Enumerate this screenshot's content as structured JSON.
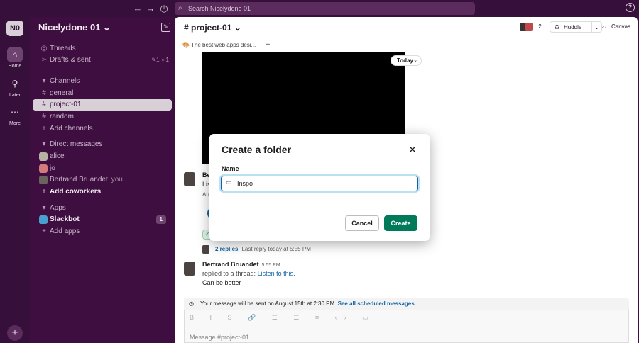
{
  "topbar": {
    "search_placeholder": "Search Nicelydone 01",
    "back_icon": "←",
    "forward_icon": "→",
    "history_icon": "◷",
    "help_icon": "?"
  },
  "rail": {
    "workspace_initials": "N0",
    "items": [
      {
        "label": "Home",
        "icon": "⌂"
      },
      {
        "label": "Later",
        "icon": "⚲"
      },
      {
        "label": "More",
        "icon": "⋯"
      }
    ],
    "add_icon": "+"
  },
  "sidebar": {
    "workspace_name": "Nicelydone 01 ⌄",
    "threads": "Threads",
    "drafts": "Drafts & sent",
    "drafts_counts": "✎1  ➢1",
    "channels_header": "Channels",
    "channels": [
      "general",
      "project-01",
      "random"
    ],
    "add_channels": "Add channels",
    "dm_header": "Direct messages",
    "dms": [
      "alice",
      "jo",
      "Bertrand Bruandet"
    ],
    "you_label": "you",
    "add_coworkers": "Add coworkers",
    "apps_header": "Apps",
    "slackbot": "Slackbot",
    "slackbot_badge": "1",
    "add_apps": "Add apps"
  },
  "channel": {
    "title": "# project-01 ⌄",
    "member_count": "2",
    "huddle_label": "Huddle",
    "canvas_label": "Canvas",
    "bookmark": "The best web apps desi...",
    "today_label": "Today"
  },
  "messages": {
    "m1_name": "Be",
    "m1_text": "Lis",
    "m1_sub": "Au",
    "replies_count": "2 replies",
    "replies_meta": "Last reply today at 5:55 PM",
    "m2_name": "Bertrand Bruandet",
    "m2_time": "5:55 PM",
    "m2_line1_prefix": "replied to a thread:",
    "m2_line1_link": "Listen to this.",
    "m2_line2": "Can be better"
  },
  "composer": {
    "scheduled_text": "Your message will be sent on August 15th at 2:30 PM.",
    "scheduled_link": "See all scheduled messages",
    "placeholder": "Message #project-01",
    "format_icons": "B I S 🔗 ☰ ☰ ≡ ‹› ▭"
  },
  "modal": {
    "title": "Create a folder",
    "close_icon": "✕",
    "name_label": "Name",
    "name_value": "Inspo",
    "cancel_label": "Cancel",
    "create_label": "Create"
  },
  "colors": {
    "sidebar_bg": "#3f0e40",
    "accent_green": "#007a5a",
    "link_blue": "#1264a3"
  }
}
